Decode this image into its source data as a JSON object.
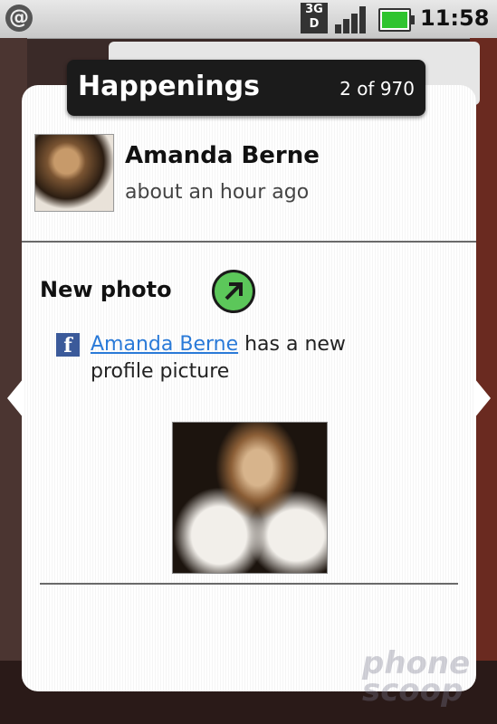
{
  "status_bar": {
    "network": "3G",
    "time": "11:58",
    "icons": [
      "at-icon",
      "3g-icon",
      "signal-icon",
      "battery-icon"
    ]
  },
  "popup": {
    "title": "Happenings",
    "counter": "2 of 970",
    "user_name": "Amanda Berne",
    "timestamp": "about an hour ago",
    "section_title": "New photo",
    "post_link": "Amanda Berne",
    "post_text": " has a new profile picture"
  },
  "watermark": "phone scoop",
  "colors": {
    "link": "#2a7ad8",
    "go_button": "#5cc75a",
    "facebook": "#3b5a9a",
    "battery": "#2fc42f"
  }
}
